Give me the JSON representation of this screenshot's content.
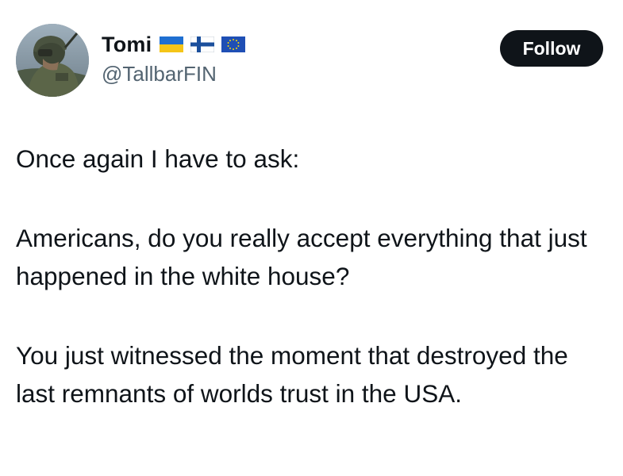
{
  "author": {
    "display_name": "Tomi",
    "handle": "@TallbarFIN",
    "avatar_icon": "soldier-avatar-icon",
    "flags": [
      "ukraine-flag-icon",
      "finland-flag-icon",
      "eu-flag-icon"
    ]
  },
  "follow_label": "Follow",
  "tweet": {
    "paragraphs": [
      "Once again I have to ask:",
      "Americans, do you really accept everything that just happened in the white house?",
      "You just witnessed the moment that destroyed the last remnants of worlds trust in the USA."
    ]
  },
  "colors": {
    "text": "#0f1419",
    "secondary_text": "#536471",
    "button_bg": "#0f1419",
    "button_text": "#ffffff",
    "background": "#ffffff"
  }
}
